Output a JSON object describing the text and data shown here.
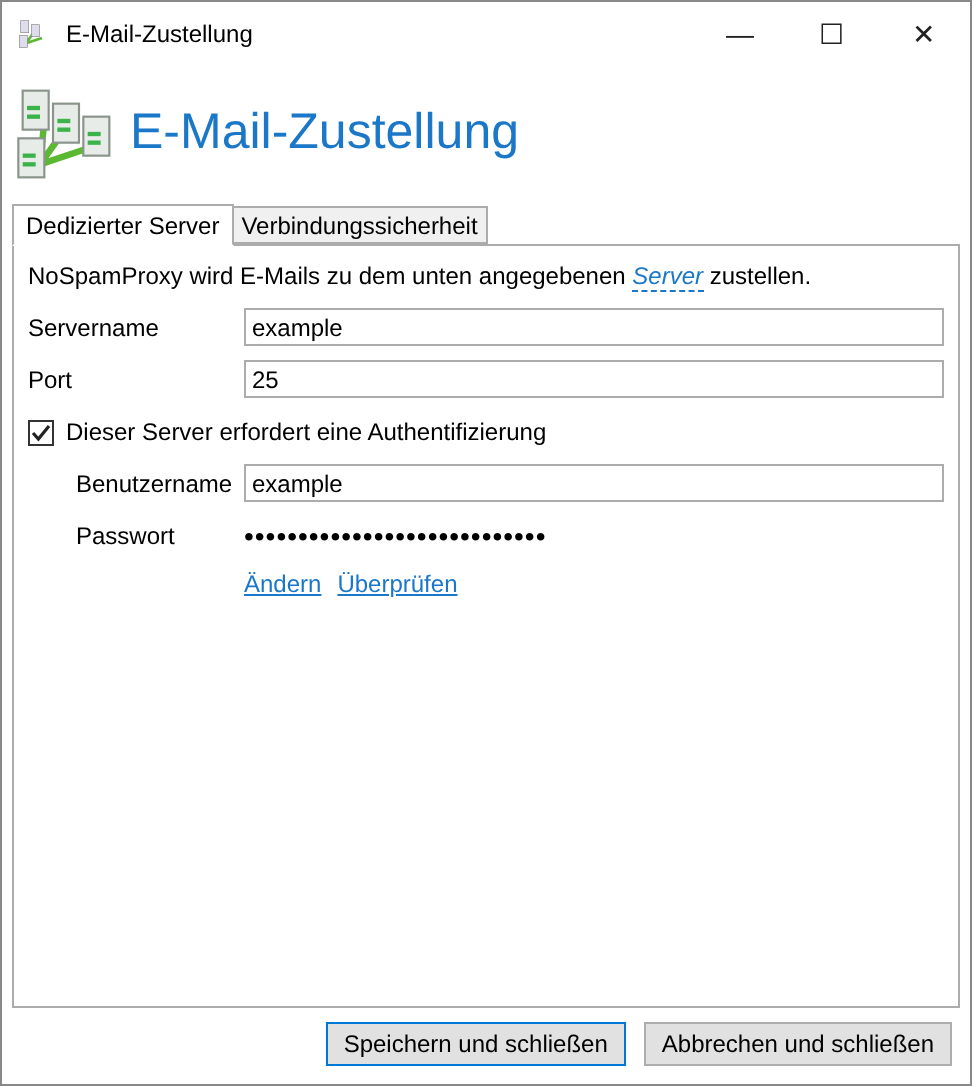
{
  "window": {
    "title": "E-Mail-Zustellung",
    "controls": [
      "—",
      "☐",
      "✕"
    ]
  },
  "header": {
    "title": "E-Mail-Zustellung"
  },
  "tabs": [
    {
      "label": "Dedizierter Server",
      "selected": true
    },
    {
      "label": "Verbindungssicherheit",
      "selected": false
    }
  ],
  "intro": {
    "before": "NoSpamProxy wird E-Mails zu dem unten angegebenen",
    "link": "Server",
    "after": "zustellen."
  },
  "fields": [
    {
      "label": "Servername",
      "value": "example"
    },
    {
      "label": "Port",
      "value": "25"
    }
  ],
  "auth": {
    "label": "Dieser Server erfordert eine Authentifizierung",
    "checked": true,
    "username": {
      "label": "Benutzername",
      "value": "example"
    },
    "password": {
      "label": "Passwort",
      "value": "••••••••••••••••••••••••••••"
    },
    "links": [
      "Ändern",
      "Überprüfen"
    ]
  },
  "buttons": [
    {
      "label": "Speichern und schließen",
      "default": true
    },
    {
      "label": "Abbrechen und schließen",
      "default": false
    }
  ]
}
